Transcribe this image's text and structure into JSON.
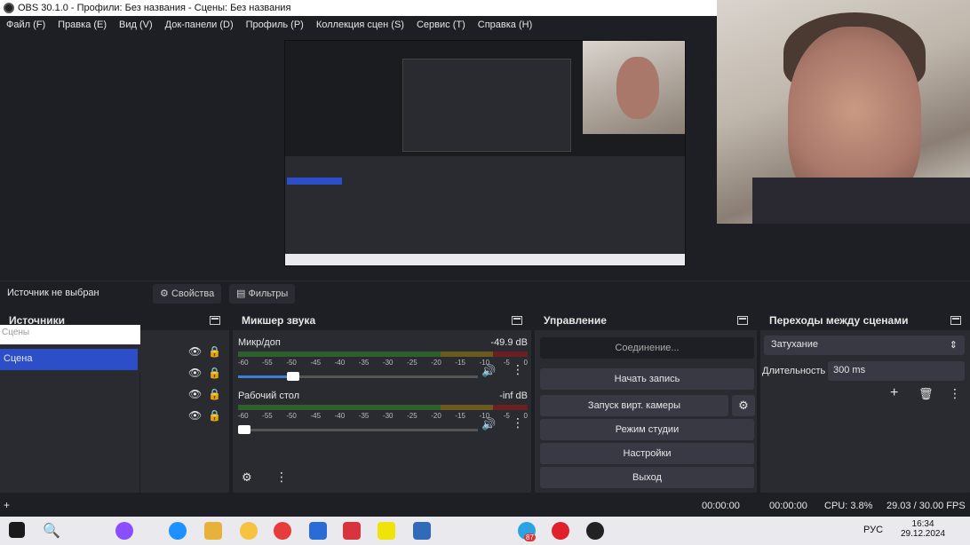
{
  "window": {
    "title": "OBS 30.1.0 - Профили: Без названия - Сцены: Без названия"
  },
  "menu": [
    "Файл (F)",
    "Правка (E)",
    "Вид (V)",
    "Док-панели (D)",
    "Профиль (P)",
    "Коллекция сцен (S)",
    "Сервис (T)",
    "Справка (H)"
  ],
  "source_bar": {
    "no_source": "Источник не выбран",
    "properties": "Свойства",
    "filters": "Фильтры"
  },
  "scenes": {
    "title": "Источники",
    "search_placeholder": "Сцены",
    "selected": "Сцена"
  },
  "mixer": {
    "title": "Микшер звука",
    "channels": [
      {
        "name": "Микр/доп",
        "level": "-49.9 dB",
        "volume_fraction": 0.23
      },
      {
        "name": "Рабочий стол",
        "level": "-inf dB",
        "volume_fraction": 0.02
      }
    ],
    "ticks": [
      "-60",
      "-55",
      "-50",
      "-45",
      "-40",
      "-35",
      "-30",
      "-25",
      "-20",
      "-15",
      "-10",
      "-5",
      "0"
    ]
  },
  "controls": {
    "title": "Управление",
    "connect": "Соединение...",
    "start_record": "Начать запись",
    "virtual_cam": "Запуск вирт. камеры",
    "studio_mode": "Режим студии",
    "settings": "Настройки",
    "exit": "Выход"
  },
  "transitions": {
    "title": "Переходы между сценами",
    "type": "Затухание",
    "duration_label": "Длительность",
    "duration": "300 ms"
  },
  "status": {
    "rec_time1": "00:00:00",
    "rec_time2": "00:00:00",
    "cpu": "CPU: 3.8%",
    "fps": "29.03 / 30.00 FPS"
  },
  "taskbar": {
    "lang": "РУС",
    "time": "16:34",
    "date": "29.12.2024",
    "badge": "87"
  },
  "colors": {
    "accent": "#2c4fc9",
    "panel": "#2a2b31",
    "bg": "#1e1f24"
  }
}
